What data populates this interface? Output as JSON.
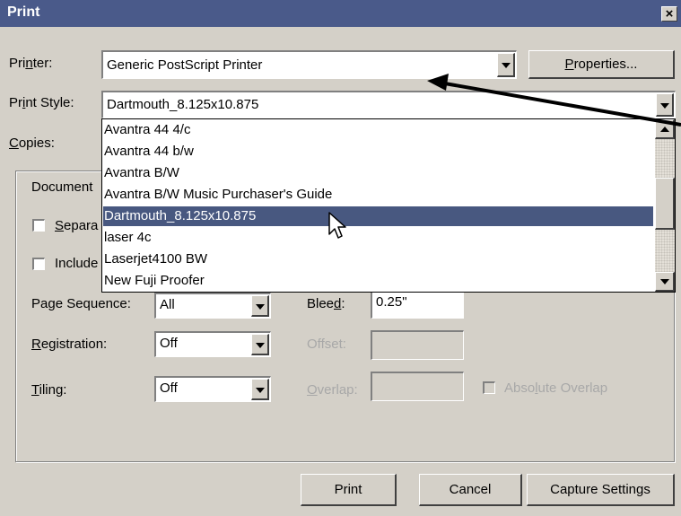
{
  "window": {
    "title": "Print",
    "close_glyph": "×"
  },
  "printer": {
    "label_pre": "Pri",
    "label_key": "n",
    "label_post": "ter:",
    "value": "Generic PostScript Printer",
    "properties_pre": "",
    "properties_key": "P",
    "properties_post": "roperties..."
  },
  "print_style": {
    "label_pre": "Pr",
    "label_key": "i",
    "label_post": "nt Style:",
    "value": "Dartmouth_8.125x10.875",
    "options": [
      "Avantra 44 4/c",
      "Avantra 44 b/w",
      "Avantra B/W",
      "Avantra B/W Music Purchaser's Guide",
      "Dartmouth_8.125x10.875",
      "laser 4c",
      "Laserjet4100 BW",
      "New Fuji Proofer"
    ],
    "selected_index": 4
  },
  "copies": {
    "label_key": "C",
    "label_post": "opies:"
  },
  "document": {
    "group_label_visible": "Document",
    "separations_key": "S",
    "separations_visible": "epara",
    "include_visible": "Include"
  },
  "page_sequence": {
    "label": "Page Sequence:",
    "value": "All"
  },
  "bleed": {
    "label_pre": "Blee",
    "label_key": "d",
    "label_post": ":",
    "value": "0.25\""
  },
  "registration": {
    "label_key": "R",
    "label_post": "egistration:",
    "value": "Off"
  },
  "offset": {
    "label": "Offset:"
  },
  "tiling": {
    "label_key": "T",
    "label_post": "iling:",
    "value": "Off"
  },
  "overlap": {
    "label_key": "O",
    "label_post": "verlap:"
  },
  "absolute_overlap": {
    "label_pre": "Abso",
    "label_key": "l",
    "label_post": "ute Overlap"
  },
  "buttons": {
    "print": "Print",
    "cancel": "Cancel",
    "capture": "Capture Settings"
  },
  "colors": {
    "titlebar": "#4a5a8a",
    "selection": "#485880",
    "face": "#d4d0c8"
  }
}
